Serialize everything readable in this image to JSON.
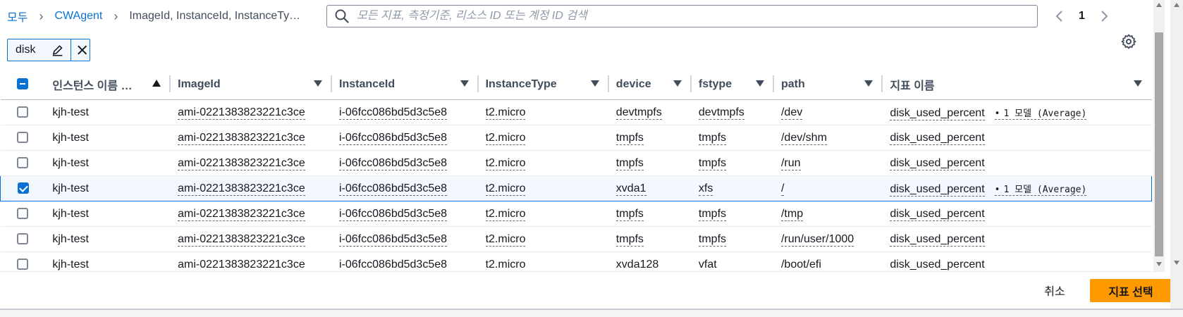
{
  "breadcrumb": {
    "items": [
      "모두",
      "CWAgent",
      "ImageId, InstanceId, InstanceTy…"
    ]
  },
  "search": {
    "value": "",
    "placeholder": "모든 지표, 측정기준, 리소스 ID 또는 계정 ID 검색"
  },
  "pagination": {
    "current_page": "1"
  },
  "filter_token": {
    "text": "disk"
  },
  "table": {
    "header_checkbox": "indeterminate",
    "sorted_column": "인스턴스 이름 …",
    "columns": [
      "인스턴스 이름 …",
      "ImageId",
      "InstanceId",
      "InstanceType",
      "device",
      "fstype",
      "path",
      "지표 이름"
    ],
    "rows": [
      {
        "selected": false,
        "name": "kjh-test",
        "image_id": "ami-0221383823221c3ce",
        "instance_id": "i-06fcc086bd5d3c5e8",
        "instance_type": "t2.micro",
        "device": "devtmpfs",
        "fstype": "devtmpfs",
        "path": "/dev",
        "metric": "disk_used_percent",
        "model": "1 모델 (Average)"
      },
      {
        "selected": false,
        "name": "kjh-test",
        "image_id": "ami-0221383823221c3ce",
        "instance_id": "i-06fcc086bd5d3c5e8",
        "instance_type": "t2.micro",
        "device": "tmpfs",
        "fstype": "tmpfs",
        "path": "/dev/shm",
        "metric": "disk_used_percent",
        "model": ""
      },
      {
        "selected": false,
        "name": "kjh-test",
        "image_id": "ami-0221383823221c3ce",
        "instance_id": "i-06fcc086bd5d3c5e8",
        "instance_type": "t2.micro",
        "device": "tmpfs",
        "fstype": "tmpfs",
        "path": "/run",
        "metric": "disk_used_percent",
        "model": ""
      },
      {
        "selected": true,
        "name": "kjh-test",
        "image_id": "ami-0221383823221c3ce",
        "instance_id": "i-06fcc086bd5d3c5e8",
        "instance_type": "t2.micro",
        "device": "xvda1",
        "fstype": "xfs",
        "path": "/",
        "metric": "disk_used_percent",
        "model": "1 모델 (Average)"
      },
      {
        "selected": false,
        "name": "kjh-test",
        "image_id": "ami-0221383823221c3ce",
        "instance_id": "i-06fcc086bd5d3c5e8",
        "instance_type": "t2.micro",
        "device": "tmpfs",
        "fstype": "tmpfs",
        "path": "/tmp",
        "metric": "disk_used_percent",
        "model": ""
      },
      {
        "selected": false,
        "name": "kjh-test",
        "image_id": "ami-0221383823221c3ce",
        "instance_id": "i-06fcc086bd5d3c5e8",
        "instance_type": "t2.micro",
        "device": "tmpfs",
        "fstype": "tmpfs",
        "path": "/run/user/1000",
        "metric": "disk_used_percent",
        "model": ""
      },
      {
        "selected": false,
        "name": "kjh-test",
        "image_id": "ami-0221383823221c3ce",
        "instance_id": "i-06fcc086bd5d3c5e8",
        "instance_type": "t2.micro",
        "device": "xvda128",
        "fstype": "vfat",
        "path": "/boot/efi",
        "metric": "disk_used_percent",
        "model": ""
      }
    ]
  },
  "footer": {
    "cancel_label": "취소",
    "primary_label": "지표 선택"
  },
  "colors": {
    "link": "#0972d3",
    "primary": "#ff9900",
    "selected_row_bg": "#f2f8fd"
  },
  "icons": [
    "search-icon",
    "chevron-left-icon",
    "chevron-right-icon",
    "edit-icon",
    "close-icon",
    "gear-icon",
    "sort-ascending-icon",
    "sort-descending-icon"
  ]
}
